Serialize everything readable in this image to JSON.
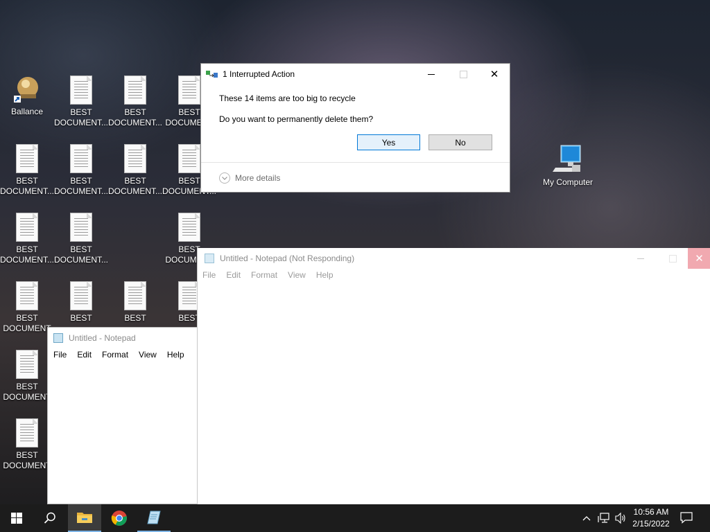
{
  "desktop": {
    "ballance_label": "Ballance",
    "doc_label_1": "BEST",
    "doc_label_2": "DOCUMENT...",
    "doc_label_2_cut": "DOCUMENT",
    "doc_label_2_cut2": "DOCUMENT",
    "my_computer_label": "My Computer"
  },
  "dialog": {
    "title": "1 Interrupted Action",
    "message1": "These 14 items are too big to recycle",
    "message2": "Do you want to permanently delete them?",
    "yes_label": "Yes",
    "no_label": "No",
    "details_label": "More details"
  },
  "notepad_main": {
    "title": "Untitled - Notepad (Not Responding)",
    "menu": [
      "File",
      "Edit",
      "Format",
      "View",
      "Help"
    ]
  },
  "notepad_back": {
    "title": "Untitled - Notepad",
    "menu": [
      "File",
      "Edit",
      "Format",
      "View",
      "Help"
    ]
  },
  "taskbar": {
    "time": "10:56 AM",
    "date": "2/15/2022"
  }
}
